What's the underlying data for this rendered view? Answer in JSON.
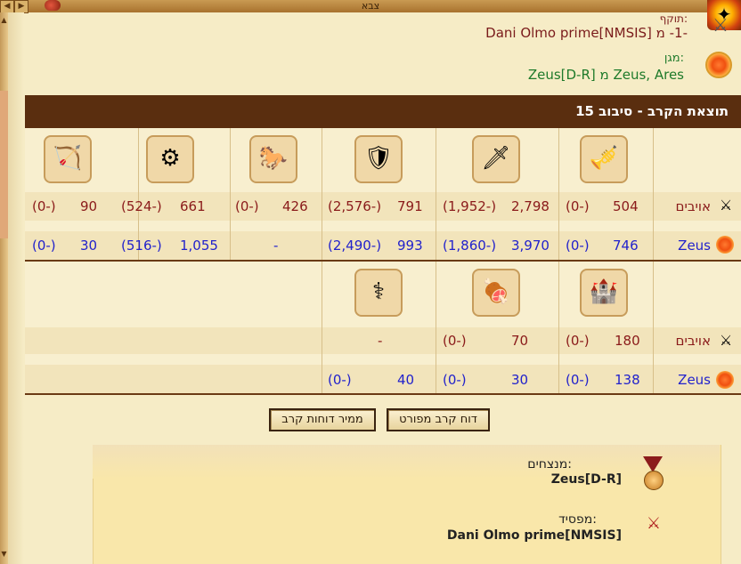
{
  "window": {
    "title": "צבא"
  },
  "attacker": {
    "label": "תוקף:",
    "text": "-1- מ Dani Olmo prime[NMSIS]"
  },
  "defender": {
    "label": "מגן:",
    "text": "Zeus, Ares מ Zeus[D-R]"
  },
  "banner": {
    "title": "תוצאת הקרב - סיבוב 15"
  },
  "section1": {
    "units": [
      "trumpeter",
      "knife-fighter",
      "hoplite",
      "chariot",
      "catapult",
      "ballista"
    ],
    "enemy_label": "אויבים",
    "enemy": [
      {
        "count": "504",
        "loss": "(0-)"
      },
      {
        "count": "2,798",
        "loss": "(1,952-)"
      },
      {
        "count": "791",
        "loss": "(2,576-)"
      },
      {
        "count": "426",
        "loss": "(0-)"
      },
      {
        "count": "661",
        "loss": "(524-)"
      },
      {
        "count": "90",
        "loss": "(0-)"
      }
    ],
    "own_label": "Zeus",
    "own": [
      {
        "count": "746",
        "loss": "(0-)"
      },
      {
        "count": "3,970",
        "loss": "(1,860-)"
      },
      {
        "count": "993",
        "loss": "(2,490-)"
      },
      {
        "count": "-",
        "loss": ""
      },
      {
        "count": "1,055",
        "loss": "(516-)"
      },
      {
        "count": "30",
        "loss": "(0-)"
      }
    ]
  },
  "section2": {
    "units": [
      "siege-tower",
      "cook",
      "physician"
    ],
    "enemy_label": "אויבים",
    "enemy": [
      {
        "count": "180",
        "loss": "(0-)"
      },
      {
        "count": "70",
        "loss": "(0-)"
      },
      {
        "count": "-",
        "loss": ""
      }
    ],
    "own_label": "Zeus",
    "own": [
      {
        "count": "138",
        "loss": "(0-)"
      },
      {
        "count": "30",
        "loss": "(0-)"
      },
      {
        "count": "40",
        "loss": "(0-)"
      }
    ]
  },
  "buttons": {
    "detailed": "דוח קרב מפורט",
    "converter": "ממיר דוחות קרב"
  },
  "result": {
    "winner_label": "מנצחים:",
    "winner": "Zeus[D-R]",
    "loser_label": "מפסיד:",
    "loser": "Dani Olmo prime[NMSIS]"
  },
  "colors": {
    "banner": "#5a2e0f",
    "enemy": "#8a1a1a",
    "own": "#2222cc",
    "defender": "#1e7a2a"
  }
}
